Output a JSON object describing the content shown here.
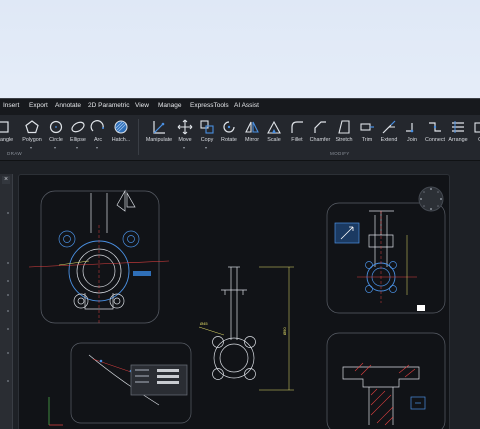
{
  "menu": [
    "Insert",
    "Export",
    "Annotate",
    "2D Parametric",
    "View",
    "Manage",
    "ExpressTools",
    "AI Assist"
  ],
  "draw_tools": [
    {
      "label": "ectangle",
      "icon": "rectangle-icon"
    },
    {
      "label": "Polygon",
      "icon": "polygon-icon"
    },
    {
      "label": "Circle",
      "icon": "circle-icon"
    },
    {
      "label": "Ellipse",
      "icon": "ellipse-icon"
    },
    {
      "label": "Arc",
      "icon": "arc-icon"
    },
    {
      "label": "Hatch...",
      "icon": "hatch-icon"
    }
  ],
  "modify_tools": [
    {
      "label": "Manipulate",
      "icon": "manipulate-icon"
    },
    {
      "label": "Move",
      "icon": "move-icon"
    },
    {
      "label": "Copy",
      "icon": "copy-icon"
    },
    {
      "label": "Rotate",
      "icon": "rotate-icon"
    },
    {
      "label": "Mirror",
      "icon": "mirror-icon"
    },
    {
      "label": "Scale",
      "icon": "scale-icon"
    },
    {
      "label": "Fillet",
      "icon": "fillet-icon"
    },
    {
      "label": "Chamfer",
      "icon": "chamfer-icon"
    },
    {
      "label": "Stretch",
      "icon": "stretch-icon"
    },
    {
      "label": "Trim",
      "icon": "trim-icon"
    },
    {
      "label": "Extend",
      "icon": "extend-icon"
    },
    {
      "label": "Join",
      "icon": "join-icon"
    },
    {
      "label": "Connect",
      "icon": "connect-icon"
    },
    {
      "label": "Arrange",
      "icon": "arrange-icon"
    },
    {
      "label": "Of",
      "icon": "offset-icon"
    }
  ],
  "groups": {
    "draw": "DRAW",
    "modify": "MODIFY"
  },
  "panel": {
    "close_glyph": "×"
  },
  "colors": {
    "accent": "#4a90e2",
    "drawing_line": "#d9dde3",
    "dimension": "#e8e36a",
    "red_axis": "#e04040"
  }
}
